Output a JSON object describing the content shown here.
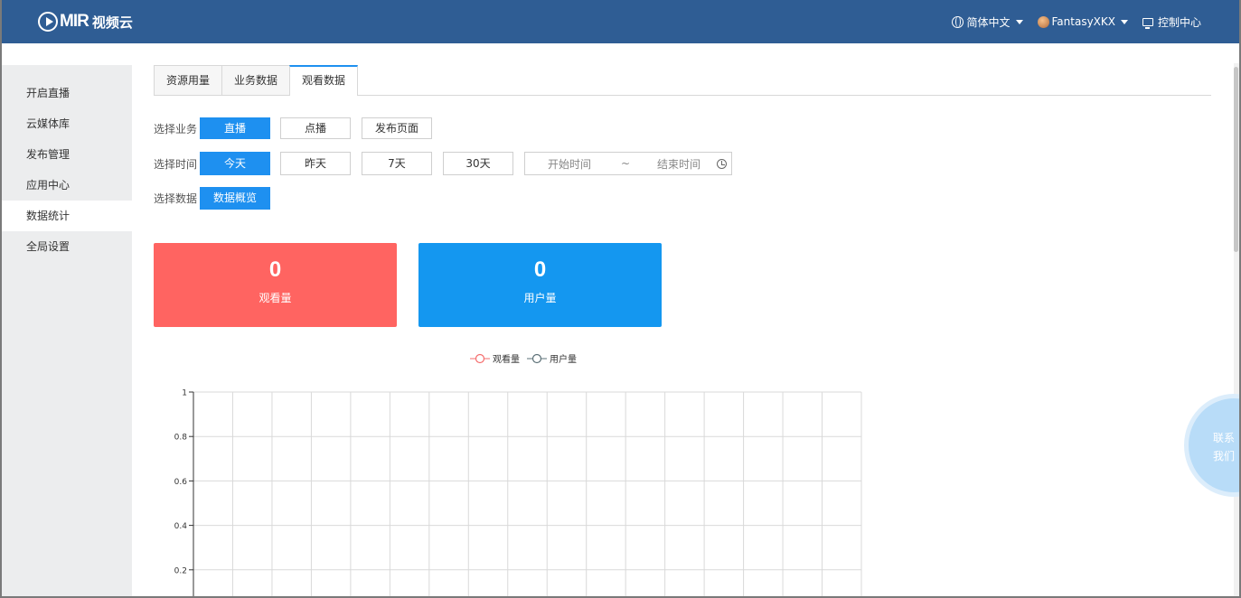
{
  "header": {
    "logo_text": "MIR",
    "logo_sub": "视频云",
    "language": "简体中文",
    "username": "FantasyXKX",
    "console": "控制中心"
  },
  "sidebar": {
    "items": [
      {
        "label": "开启直播"
      },
      {
        "label": "云媒体库"
      },
      {
        "label": "发布管理"
      },
      {
        "label": "应用中心"
      },
      {
        "label": "数据统计"
      },
      {
        "label": "全局设置"
      }
    ],
    "active_index": 4
  },
  "tabs": [
    {
      "label": "资源用量"
    },
    {
      "label": "业务数据"
    },
    {
      "label": "观看数据"
    }
  ],
  "active_tab": 2,
  "filters": {
    "business": {
      "label": "选择业务",
      "options": [
        "直播",
        "点播",
        "发布页面"
      ],
      "selected": 0
    },
    "time": {
      "label": "选择时间",
      "options": [
        "今天",
        "昨天",
        "7天",
        "30天"
      ],
      "selected": 0,
      "start_placeholder": "开始时间",
      "tilde": "~",
      "end_placeholder": "结束时间"
    },
    "data": {
      "label": "选择数据",
      "options": [
        "数据概览"
      ],
      "selected": 0
    }
  },
  "stats": {
    "views": {
      "value": "0",
      "label": "观看量",
      "color": "#ff6461"
    },
    "users": {
      "value": "0",
      "label": "用户量",
      "color": "#1497f0"
    }
  },
  "contact": {
    "label": "联系我们"
  },
  "chart_data": {
    "type": "line",
    "series": [
      {
        "name": "观看量",
        "values": [],
        "color": "#f56c6c"
      },
      {
        "name": "用户量",
        "values": [],
        "color": "#5b7077"
      }
    ],
    "y_ticks": [
      "1",
      "0.8",
      "0.6",
      "0.4",
      "0.2"
    ],
    "ylim": [
      0,
      1
    ],
    "grid": true,
    "legend_position": "top-center"
  }
}
